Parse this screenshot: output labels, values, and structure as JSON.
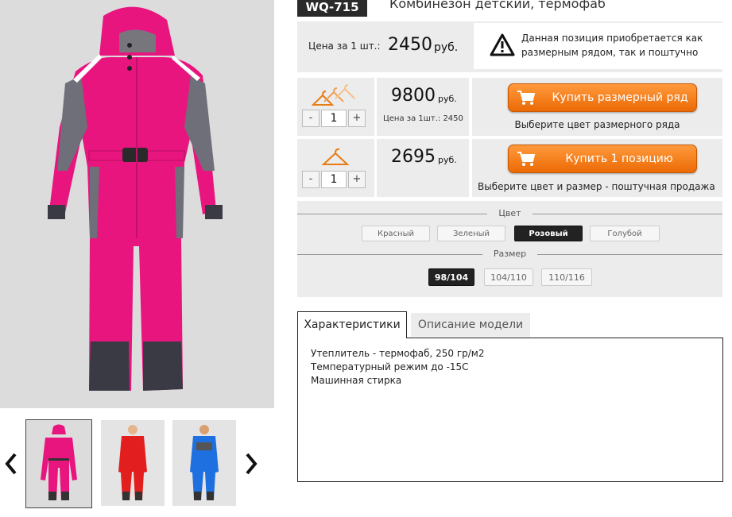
{
  "product": {
    "sku": "WQ-715",
    "title": "Комбинезон детский, термофаб",
    "main_image_icon": "pink-snowsuit-image"
  },
  "gallery": {
    "prev_icon": "chevron-left-icon",
    "next_icon": "chevron-right-icon",
    "thumbnails": [
      {
        "icon": "pink-snowsuit-thumbnail",
        "active": true
      },
      {
        "icon": "red-snowsuit-thumbnail",
        "active": false
      },
      {
        "icon": "blue-snowsuit-thumbnail",
        "active": false
      }
    ]
  },
  "price": {
    "label": "Цена за 1 шт.:",
    "value": "2450",
    "unit": "руб."
  },
  "notice": {
    "icon": "warning-icon",
    "text": "Данная позиция приобретается как размерным рядом, так и поштучно"
  },
  "buy_set": {
    "icon": "three-hangers-icon",
    "quantity": "1",
    "minus": "-",
    "plus": "+",
    "total": "9800",
    "unit": "руб.",
    "note": "Цена за 1шт.: 2450",
    "button_label": "Купить размерный ряд",
    "button_icon": "cart-icon",
    "hint": "Выберите цвет размерного ряда"
  },
  "buy_single": {
    "icon": "hanger-icon",
    "quantity": "1",
    "minus": "-",
    "plus": "+",
    "total": "2695",
    "unit": "руб.",
    "button_label": "Купить 1 позицию",
    "button_icon": "cart-icon",
    "hint": "Выберите цвет и размер - поштучная продажа"
  },
  "colors": {
    "title": "Цвет",
    "options": [
      {
        "label": "Красный",
        "selected": false
      },
      {
        "label": "Зеленый",
        "selected": false
      },
      {
        "label": "Розовый",
        "selected": true
      },
      {
        "label": "Голубой",
        "selected": false
      }
    ]
  },
  "sizes": {
    "title": "Размер",
    "options": [
      {
        "label": "98/104",
        "selected": true
      },
      {
        "label": "104/110",
        "selected": false
      },
      {
        "label": "110/116",
        "selected": false
      }
    ]
  },
  "tabs": {
    "items": [
      {
        "label": "Характеристики",
        "active": true
      },
      {
        "label": "Описание модели",
        "active": false
      }
    ],
    "content": [
      "Утеплитель - термофаб, 250 гр/м2",
      "Температурный режим до -15С",
      "Машинная стирка"
    ]
  },
  "colors_palette": {
    "accent_orange": "#f07a12",
    "panel_gray": "#ececec",
    "selected_dark": "#222222",
    "product_pink": "#e8157f"
  }
}
